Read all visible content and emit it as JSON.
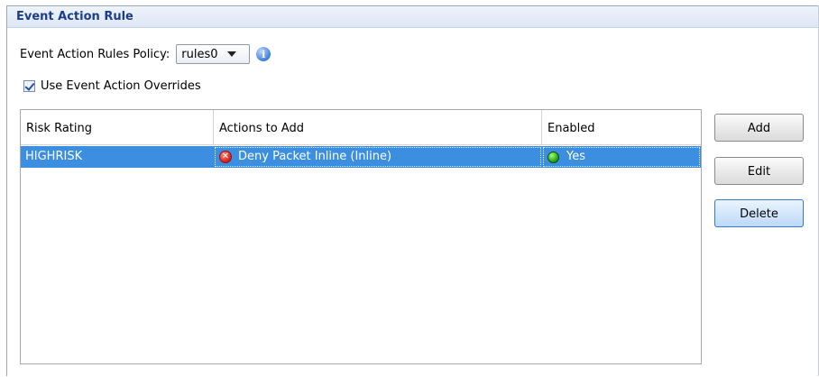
{
  "panel": {
    "title": "Event Action Rule"
  },
  "policy": {
    "label": "Event Action Rules Policy:",
    "selected": "rules0",
    "info_icon": "info-icon"
  },
  "overrides": {
    "label": "Use Event Action Overrides",
    "checked": true
  },
  "table": {
    "columns": [
      "Risk Rating",
      "Actions to Add",
      "Enabled"
    ],
    "rows": [
      {
        "risk_rating": "HIGHRISK",
        "action": "Deny Packet Inline (Inline)",
        "action_icon": "deny-icon",
        "enabled": "Yes",
        "enabled_icon": "green-status-icon",
        "selected": true
      }
    ]
  },
  "buttons": {
    "add": "Add",
    "edit": "Edit",
    "delete": "Delete"
  },
  "colors": {
    "title": "#1c3d8c",
    "selection": "#3c8fe0",
    "deny": "#d21f12",
    "enabled": "#1e9a12"
  }
}
